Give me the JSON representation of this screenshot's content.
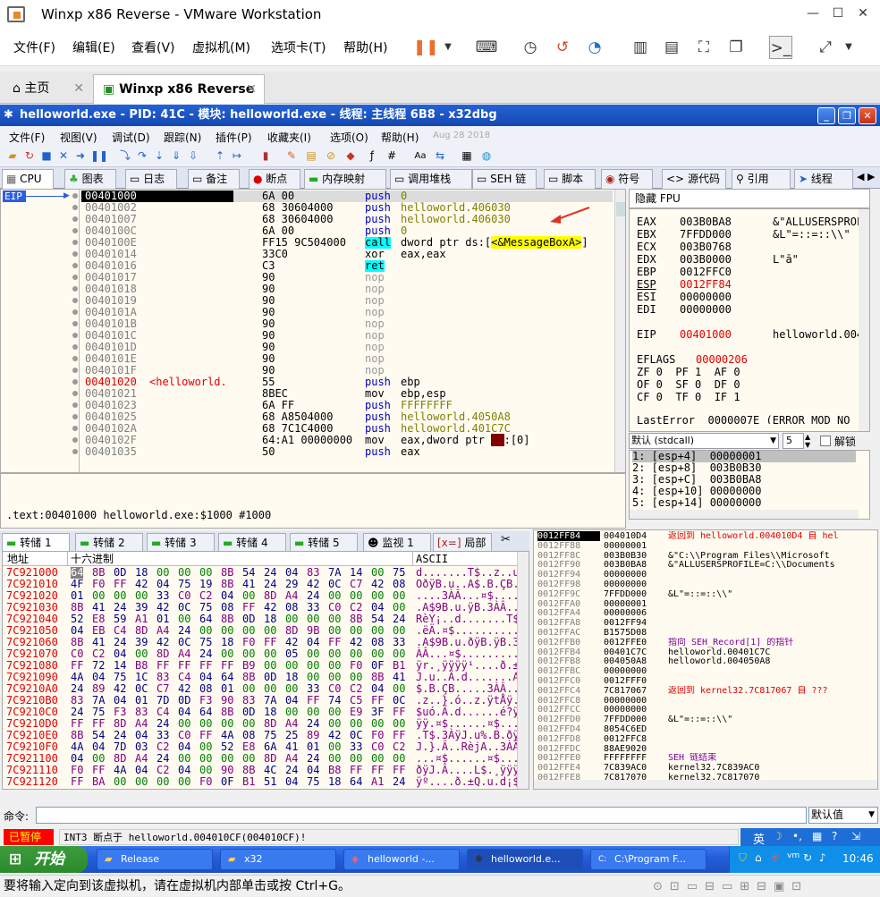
{
  "vm": {
    "title": "Winxp x86 Reverse - VMware Workstation",
    "menu": [
      "文件(F)",
      "编辑(E)",
      "查看(V)",
      "虚拟机(M)",
      "选项卡(T)",
      "帮助(H)"
    ],
    "tabs": [
      "主页",
      "Winxp x86 Reverse"
    ],
    "status_text": "要将输入定向到该虚拟机，请在虚拟机内部单击或按 Ctrl+G。"
  },
  "dbg": {
    "title": "helloworld.exe - PID: 41C - 模块: helloworld.exe - 线程: 主线程 6B8 - x32dbg",
    "menu": [
      "文件(F)",
      "视图(V)",
      "调试(D)",
      "跟踪(N)",
      "插件(P)",
      "收藏夹(I)",
      "选项(O)",
      "帮助(H)",
      "Aug 28 2018"
    ],
    "tabs": [
      "CPU",
      "图表",
      "日志",
      "备注",
      "断点",
      "内存映射",
      "调用堆栈",
      "SEH 链",
      "脚本",
      "符号",
      "源代码",
      "引用",
      "线程"
    ],
    "eip_label": "EIP"
  },
  "disasm": [
    {
      "addr": "00401000",
      "bytes": "6A 00",
      "op": "push",
      "arg": "0",
      "cls": "blue",
      "argcls": "olive",
      "selected": true
    },
    {
      "addr": "00401002",
      "bytes": "68 30604000",
      "op": "push",
      "arg": "helloworld.406030",
      "cls": "blue",
      "argcls": "olive"
    },
    {
      "addr": "00401007",
      "bytes": "68 30604000",
      "op": "push",
      "arg": "helloworld.406030",
      "cls": "blue",
      "argcls": "olive"
    },
    {
      "addr": "0040100C",
      "bytes": "6A 00",
      "op": "push",
      "arg": "0",
      "cls": "blue",
      "argcls": "olive"
    },
    {
      "addr": "0040100E",
      "bytes": "FF15 9C504000",
      "op": "call",
      "arg": "dword ptr ds:[<&MessageBoxA>]",
      "cls": "call",
      "argcls": "black"
    },
    {
      "addr": "00401014",
      "bytes": "33C0",
      "op": "xor",
      "arg": "eax,eax",
      "cls": "black",
      "argcls": "black"
    },
    {
      "addr": "00401016",
      "bytes": "C3",
      "op": "ret",
      "arg": "",
      "cls": "ret",
      "argcls": "black"
    },
    {
      "addr": "00401017",
      "bytes": "90",
      "op": "nop",
      "arg": "",
      "cls": "gray",
      "argcls": "black"
    },
    {
      "addr": "00401018",
      "bytes": "90",
      "op": "nop",
      "arg": "",
      "cls": "gray",
      "argcls": "black"
    },
    {
      "addr": "00401019",
      "bytes": "90",
      "op": "nop",
      "arg": "",
      "cls": "gray",
      "argcls": "black"
    },
    {
      "addr": "0040101A",
      "bytes": "90",
      "op": "nop",
      "arg": "",
      "cls": "gray",
      "argcls": "black"
    },
    {
      "addr": "0040101B",
      "bytes": "90",
      "op": "nop",
      "arg": "",
      "cls": "gray",
      "argcls": "black"
    },
    {
      "addr": "0040101C",
      "bytes": "90",
      "op": "nop",
      "arg": "",
      "cls": "gray",
      "argcls": "black"
    },
    {
      "addr": "0040101D",
      "bytes": "90",
      "op": "nop",
      "arg": "",
      "cls": "gray",
      "argcls": "black"
    },
    {
      "addr": "0040101E",
      "bytes": "90",
      "op": "nop",
      "arg": "",
      "cls": "gray",
      "argcls": "black"
    },
    {
      "addr": "0040101F",
      "bytes": "90",
      "op": "nop",
      "arg": "",
      "cls": "gray",
      "argcls": "black"
    },
    {
      "addr": "00401020",
      "label": "<helloworld.",
      "bytes": "55",
      "op": "push",
      "arg": "ebp",
      "cls": "blue",
      "argcls": "black",
      "red": true
    },
    {
      "addr": "00401021",
      "bytes": "8BEC",
      "op": "mov",
      "arg": "ebp,esp",
      "cls": "black",
      "argcls": "black"
    },
    {
      "addr": "00401023",
      "bytes": "6A FF",
      "op": "push",
      "arg": "FFFFFFFF",
      "cls": "blue",
      "argcls": "olive"
    },
    {
      "addr": "00401025",
      "bytes": "68 A8504000",
      "op": "push",
      "arg": "helloworld.4050A8",
      "cls": "blue",
      "argcls": "olive"
    },
    {
      "addr": "0040102A",
      "bytes": "68 7C1C4000",
      "op": "push",
      "arg": "helloworld.401C7C",
      "cls": "blue",
      "argcls": "olive"
    },
    {
      "addr": "0040102F",
      "bytes": "64:A1 00000000",
      "op": "mov",
      "arg": "eax,dword ptr fs:[0]",
      "cls": "black",
      "argcls": "black"
    },
    {
      "addr": "00401035",
      "bytes": "50",
      "op": "push",
      "arg": "eax",
      "cls": "blue",
      "argcls": "black"
    }
  ],
  "regs_header": "隐藏 FPU",
  "registers": [
    {
      "name": "EAX",
      "val": "003B0BA8",
      "note": "&\"ALLUSERSPROF"
    },
    {
      "name": "EBX",
      "val": "7FFDD000",
      "note": "&L\"=::=::\\\\\""
    },
    {
      "name": "ECX",
      "val": "003B0768",
      "note": ""
    },
    {
      "name": "EDX",
      "val": "003B0000",
      "note": "L\"ā\""
    },
    {
      "name": "EBP",
      "val": "0012FFC0",
      "note": ""
    },
    {
      "name": "ESP",
      "val": "0012FF84",
      "note": "",
      "red": true
    },
    {
      "name": "ESI",
      "val": "00000000",
      "note": ""
    },
    {
      "name": "EDI",
      "val": "00000000",
      "note": ""
    }
  ],
  "eip_reg": {
    "name": "EIP",
    "val": "00401000",
    "note": "helloworld.004"
  },
  "eflags": {
    "name": "EFLAGS",
    "val": "00000206"
  },
  "flags_lines": [
    "ZF 0  PF 1  AF 0",
    "OF 0  SF 0  DF 0",
    "CF 0  TF 0  IF 1"
  ],
  "lasterror": "LastError  0000007E (ERROR_MOD_NO",
  "callconv": {
    "label": "默认 (stdcall)",
    "count": "5",
    "unlock": "解锁"
  },
  "stack_args": [
    "1: [esp+4]  00000001",
    "2: [esp+8]  003B0B30",
    "3: [esp+C]  003B0BA8",
    "4: [esp+10] 00000000",
    "5: [esp+14] 00000000"
  ],
  "info_text": ".text:00401000 helloworld.exe:$1000 #1000",
  "dump_tabs": [
    "转储 1",
    "转储 2",
    "转储 3",
    "转储 4",
    "转储 5",
    "监视 1",
    "局部"
  ],
  "dump_headers": {
    "addr": "地址",
    "hex": "十六进制",
    "ascii": "ASCII"
  },
  "dump": [
    {
      "addr": "7C921000",
      "hex": "64 8B 0D 18 00 00 00 8B 54 24 04 83 7A 14 00 75",
      "ascii": "d.......T$..z..u"
    },
    {
      "addr": "7C921010",
      "hex": "4F F0 FF 42 04 75 19 8B 41 24 29 42 0C C7 42 08",
      "ascii": "OðÿB.u..A$.B.ÇB."
    },
    {
      "addr": "7C921020",
      "hex": "01 00 00 00 33 C0 C2 04 00 8D A4 24 00 00 00 00",
      "ascii": "....3ÀÂ...¤$...."
    },
    {
      "addr": "7C921030",
      "hex": "8B 41 24 39 42 0C 75 08 FF 42 08 33 C0 C2 04 00",
      "ascii": ".A$9B.u.ÿB.3ÀÂ.."
    },
    {
      "addr": "7C921040",
      "hex": "52 E8 59 A1 01 00 64 8B 0D 18 00 00 00 8B 54 24",
      "ascii": "RèY¡..d.......T$"
    },
    {
      "addr": "7C921050",
      "hex": "04 EB C4 8D A4 24 00 00 00 00 8D 9B 00 00 00 00",
      "ascii": ".ëÄ.¤$.........."
    },
    {
      "addr": "7C921060",
      "hex": "8B 41 24 39 42 0C 75 18 F0 FF 42 04 FF 42 08 33",
      "ascii": ".A$9B.u.ðÿB.ÿB.3"
    },
    {
      "addr": "7C921070",
      "hex": "C0 C2 04 00 8D A4 24 00 00 00 05 00 00 00 00 00",
      "ascii": "ÀÂ...¤$........."
    },
    {
      "addr": "7C921080",
      "hex": "FF 72 14 B8 FF FF FF FF B9 00 00 00 00 F0 0F B1",
      "ascii": "ÿr.¸ÿÿÿÿ¹....ð.±"
    },
    {
      "addr": "7C921090",
      "hex": "4A 04 75 1C 83 C4 04 64 8B 0D 18 00 00 00 8B 41",
      "ascii": "J.u..Ä.d.......A"
    },
    {
      "addr": "7C9210A0",
      "hex": "24 89 42 0C C7 42 08 01 00 00 00 33 C0 C2 04 00",
      "ascii": "$.B.ÇB.....3ÀÂ.."
    },
    {
      "addr": "7C9210B0",
      "hex": "83 7A 04 01 7D 0D F3 90 83 7A 04 FF 74 C5 FF 0C",
      "ascii": ".z..}.ó..z.ÿtÅÿ."
    },
    {
      "addr": "7C9210C0",
      "hex": "24 75 F3 83 C4 04 64 8B 0D 18 00 00 00 E9 3F FF",
      "ascii": "$uó.Ä.d......é?ÿ"
    },
    {
      "addr": "7C9210D0",
      "hex": "FF FF 8D A4 24 00 00 00 00 8D A4 24 00 00 00 00",
      "ascii": "ÿÿ.¤$......¤$...."
    },
    {
      "addr": "7C9210E0",
      "hex": "8B 54 24 04 33 C0 FF 4A 08 75 25 89 42 0C F0 FF",
      "ascii": ".T$.3ÀÿJ.u%.B.ðÿ"
    },
    {
      "addr": "7C9210F0",
      "hex": "4A 04 7D 03 C2 04 00 52 E8 6A 41 01 00 33 C0 C2",
      "ascii": "J.}.Â..RèjA..3ÀÂ"
    },
    {
      "addr": "7C921100",
      "hex": "04 00 8D A4 24 00 00 00 00 8D A4 24 00 00 00 00",
      "ascii": "...¤$......¤$...."
    },
    {
      "addr": "7C921110",
      "hex": "F0 FF 4A 04 C2 04 00 90 8B 4C 24 04 B8 FF FF FF",
      "ascii": "ðÿJ.Â....L$.¸ÿÿÿ"
    },
    {
      "addr": "7C921120",
      "hex": "FF BA 00 00 00 00 F0 0F B1 51 04 75 18 64 A1 24",
      "ascii": "ÿº....ð.±Q.u.d¡$"
    }
  ],
  "stack": [
    {
      "addr": "0012FF84",
      "val": "004010D4",
      "note": "返回到 helloworld.004010D4 自 hel",
      "sel": true,
      "red": true
    },
    {
      "addr": "0012FF88",
      "val": "00000001",
      "note": ""
    },
    {
      "addr": "0012FF8C",
      "val": "003B0B30",
      "note": "&\"C:\\\\Program Files\\\\Microsoft"
    },
    {
      "addr": "0012FF90",
      "val": "003B0BA8",
      "note": "&\"ALLUSERSPROFILE=C:\\\\Documents"
    },
    {
      "addr": "0012FF94",
      "val": "00000000",
      "note": ""
    },
    {
      "addr": "0012FF98",
      "val": "00000000",
      "note": ""
    },
    {
      "addr": "0012FF9C",
      "val": "7FFDD000",
      "note": "&L\"=::=::\\\\\""
    },
    {
      "addr": "0012FFA0",
      "val": "00000001",
      "note": ""
    },
    {
      "addr": "0012FFA4",
      "val": "00000006",
      "note": ""
    },
    {
      "addr": "0012FFA8",
      "val": "0012FF94",
      "note": ""
    },
    {
      "addr": "0012FFAC",
      "val": "B1575D08",
      "note": ""
    },
    {
      "addr": "0012FFB0",
      "val": "0012FFE0",
      "note": "指向 SEH_Record[1] 的指针",
      "purple": true
    },
    {
      "addr": "0012FFB4",
      "val": "00401C7C",
      "note": "helloworld.00401C7C"
    },
    {
      "addr": "0012FFB8",
      "val": "004050A8",
      "note": "helloworld.004050A8"
    },
    {
      "addr": "0012FFBC",
      "val": "00000000",
      "note": ""
    },
    {
      "addr": "0012FFC0",
      "val": "0012FFF0",
      "note": ""
    },
    {
      "addr": "0012FFC4",
      "val": "7C817067",
      "note": "返回到 kernel32.7C817067 自 ???",
      "red": true
    },
    {
      "addr": "0012FFC8",
      "val": "00000000",
      "note": ""
    },
    {
      "addr": "0012FFCC",
      "val": "00000000",
      "note": ""
    },
    {
      "addr": "0012FFD0",
      "val": "7FFDD000",
      "note": "&L\"=::=::\\\\\""
    },
    {
      "addr": "0012FFD4",
      "val": "8054C6ED",
      "note": ""
    },
    {
      "addr": "0012FFD8",
      "val": "0012FFC8",
      "note": ""
    },
    {
      "addr": "0012FFDC",
      "val": "88AE9020",
      "note": ""
    },
    {
      "addr": "0012FFE0",
      "val": "FFFFFFFF",
      "note": "SEH 链结束",
      "purple": true
    },
    {
      "addr": "0012FFE4",
      "val": "7C839AC0",
      "note": "kernel32.7C839AC0"
    },
    {
      "addr": "0012FFE8",
      "val": "7C817070",
      "note": "kernel32.7C817070"
    }
  ],
  "cmd": {
    "label": "命令:",
    "value": "",
    "default": "默认值"
  },
  "status": {
    "state": "已暂停",
    "message": "INT3 断点于 helloworld.004010CF(004010CF)!"
  },
  "taskbar": {
    "start": "开始",
    "tasks": [
      "Release",
      "x32",
      "helloworld -...",
      "helloworld.e...",
      "C:\\Program F..."
    ],
    "ime": "英",
    "clock": "10:46"
  },
  "colors": {
    "xp_blue": "#245edb",
    "selection": "#000000",
    "eip_blue": "#2b5fe0",
    "paused": "#ff0000"
  }
}
